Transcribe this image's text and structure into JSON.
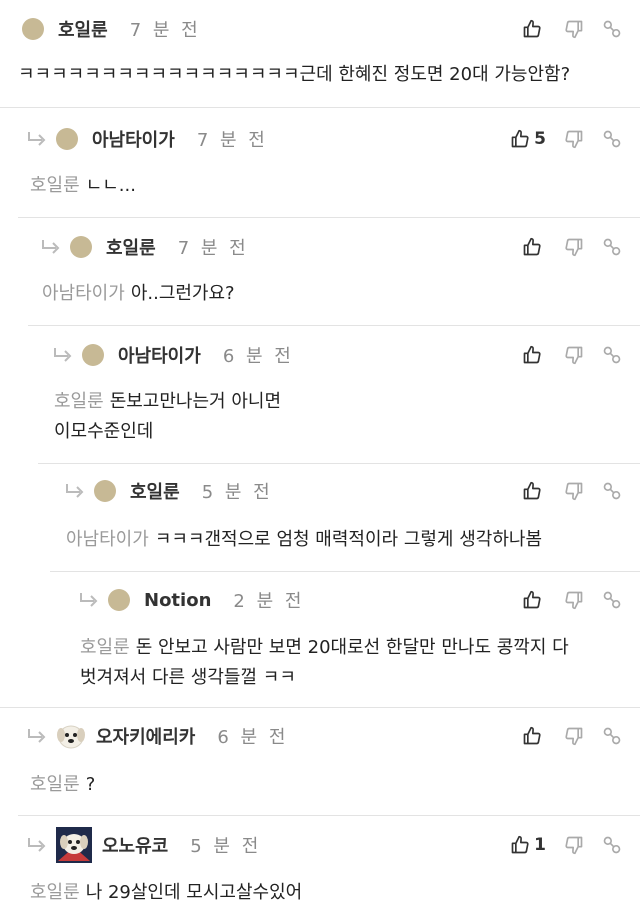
{
  "comments": [
    {
      "nick": "호일룬",
      "time": "7 분 전",
      "mention": "",
      "text": "ㅋㅋㅋㅋㅋㅋㅋㅋㅋㅋㅋㅋㅋㅋㅋㅋㅋ근데 한혜진 정도면 20대 가능안함?",
      "likes": ""
    },
    {
      "nick": "아남타이가",
      "time": "7 분 전",
      "mention": "호일룬",
      "text": "ㄴㄴ...",
      "likes": "5"
    },
    {
      "nick": "호일룬",
      "time": "7 분 전",
      "mention": "아남타이가",
      "text": "아..그런가요?",
      "likes": ""
    },
    {
      "nick": "아남타이가",
      "time": "6 분 전",
      "mention": "호일룬",
      "text": "돈보고만나는거 아니면",
      "text2": "이모수준인데",
      "likes": ""
    },
    {
      "nick": "호일룬",
      "time": "5 분 전",
      "mention": "아남타이가",
      "text": "ㅋㅋㅋ갠적으로 엄청 매력적이라 그렇게 생각하나봄",
      "likes": ""
    },
    {
      "nick": "Notion",
      "time": "2 분 전",
      "mention": "호일룬",
      "text": "돈 안보고 사람만 보면 20대로선 한달만 만나도 콩깍지 다",
      "text2": "벗겨져서 다른 생각들껄 ㅋㅋ",
      "likes": ""
    },
    {
      "nick": "오자키에리카",
      "time": "6 분 전",
      "mention": "호일룬",
      "text": "?",
      "likes": ""
    },
    {
      "nick": "오노유코",
      "time": "5 분 전",
      "mention": "호일룬",
      "text": "나 29살인데 모시고살수있어",
      "likes": "1"
    }
  ]
}
